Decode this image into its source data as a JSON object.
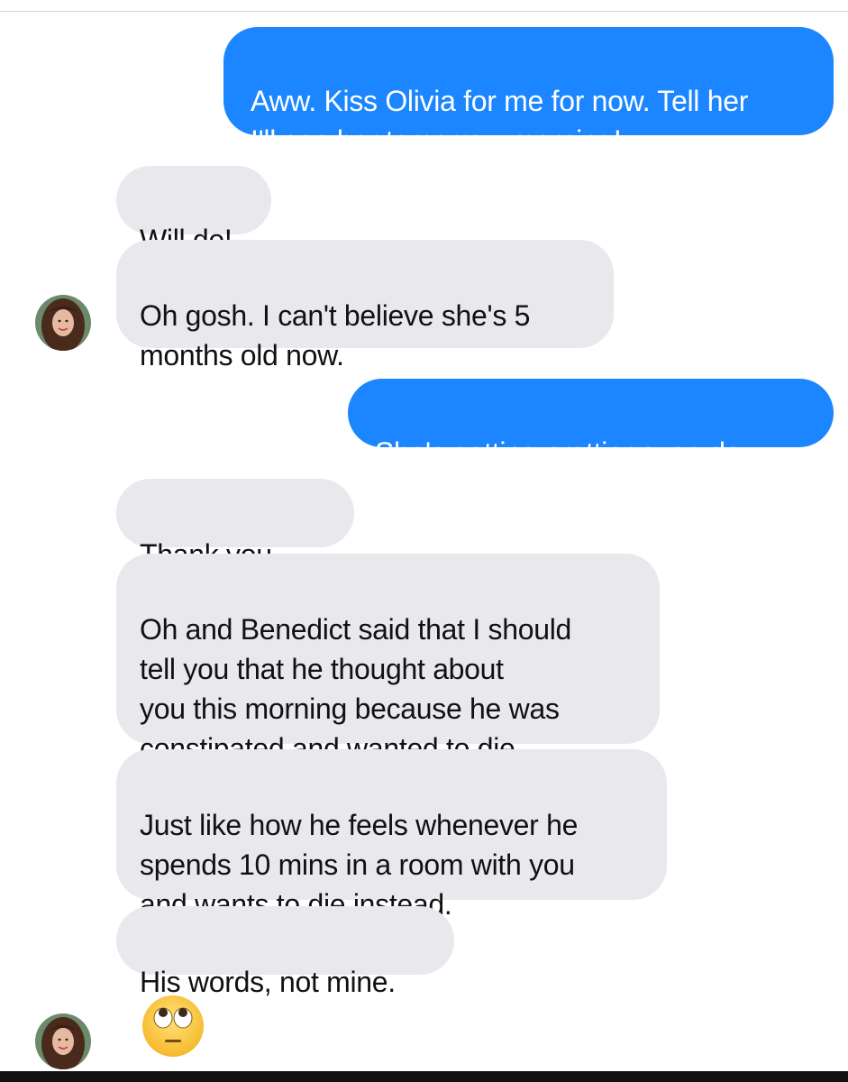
{
  "messages": [
    {
      "id": "m1",
      "direction": "sent",
      "text": "Aww. Kiss Olivia for me for now. Tell her\nI'll see her tomorrow morning!"
    },
    {
      "id": "m2",
      "direction": "received",
      "text": "Will do!"
    },
    {
      "id": "m3",
      "direction": "received",
      "text": "Oh gosh. I can't believe she's 5\nmonths old now."
    },
    {
      "id": "m4",
      "direction": "sent",
      "text": "She's getting prettier everyday."
    },
    {
      "id": "m5",
      "direction": "received",
      "text": "Thank you",
      "emoji": "❤️"
    },
    {
      "id": "m6",
      "direction": "received",
      "text": "Oh and Benedict said that I should\ntell you that he thought about\nyou this morning because he was\nconstipated and wanted to die."
    },
    {
      "id": "m7",
      "direction": "received",
      "text": "Just like how he feels whenever he\nspends 10 mins in a room with you\nand wants to die instead."
    },
    {
      "id": "m8",
      "direction": "received",
      "text": "His words, not mine."
    },
    {
      "id": "m9",
      "direction": "received",
      "emoji_icon": "face-with-rolling-eyes-icon"
    }
  ],
  "colors": {
    "sent_bubble": "#1b86ff",
    "received_bubble": "#e8e8ed",
    "heart": "#e8202b"
  }
}
